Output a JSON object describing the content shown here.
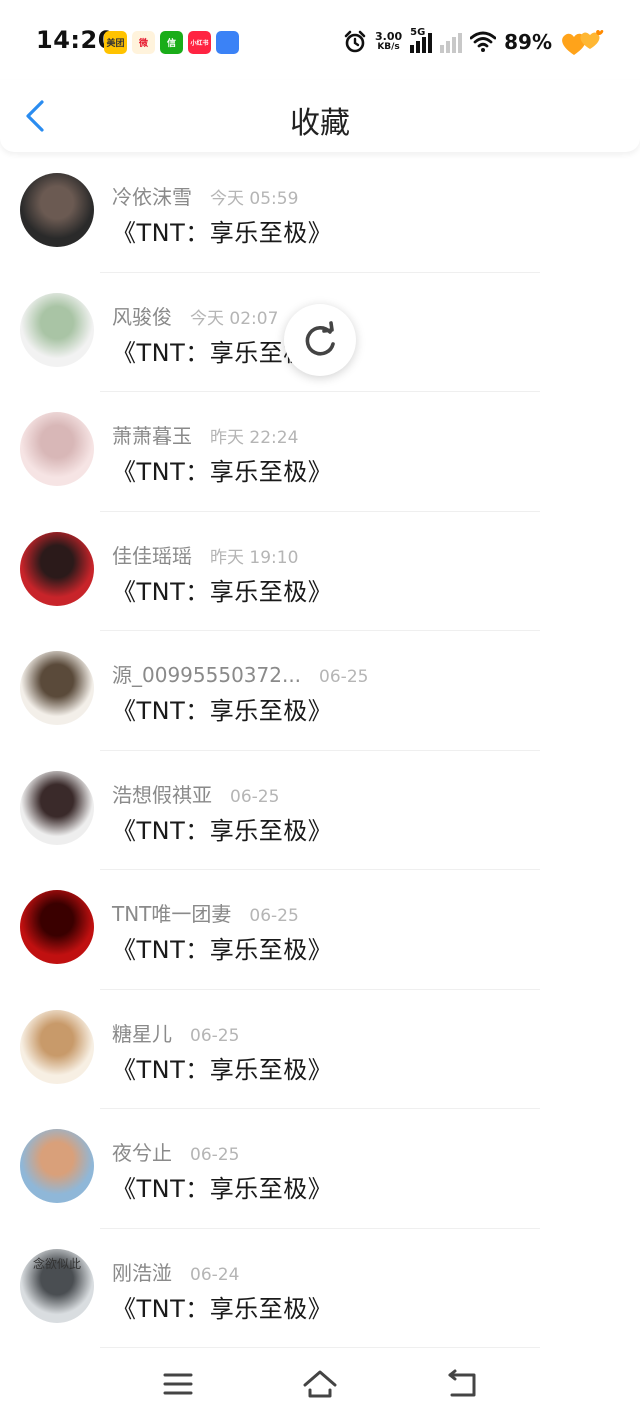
{
  "status_bar": {
    "time": "14:20",
    "apps": [
      {
        "name": "meituan",
        "label": "美团",
        "color": "#ffc300",
        "text_color": "#333333"
      },
      {
        "name": "weibo",
        "label": "微",
        "color": "#fff3dc",
        "text_color": "#e6162d"
      },
      {
        "name": "wechat",
        "label": "信",
        "color": "#1aad19",
        "text_color": "#ffffff"
      },
      {
        "name": "xiaohongshu",
        "label": "小红书",
        "color": "#ff2442",
        "text_color": "#ffffff"
      },
      {
        "name": "app5",
        "label": "",
        "color": "#3b82f6",
        "text_color": "#ffffff"
      }
    ],
    "net_speed_value": "3.00",
    "net_speed_unit": "KB/s",
    "network_type": "5G",
    "battery": "89%"
  },
  "header": {
    "title": "收藏"
  },
  "favorites": [
    {
      "user": "冷依沫雪",
      "time": "今天 05:59",
      "title": "《TNT：享乐至极》",
      "avatar_colors": [
        "#2a2a2a",
        "#6b5a52"
      ]
    },
    {
      "user": "风骏俊",
      "time": "今天 02:07",
      "title": "《TNT：享乐至极》",
      "avatar_colors": [
        "#f2f2f2",
        "#a9c4a5"
      ]
    },
    {
      "user": "萧萧暮玉",
      "time": "昨天 22:24",
      "title": "《TNT：享乐至极》",
      "avatar_colors": [
        "#f6e4e4",
        "#d8b7b7"
      ]
    },
    {
      "user": "佳佳瑶瑶",
      "time": "昨天 19:10",
      "title": "《TNT：享乐至极》",
      "avatar_colors": [
        "#c8242a",
        "#2b1a1a"
      ]
    },
    {
      "user": "源_00995550372...",
      "time": "06-25",
      "title": "《TNT：享乐至极》",
      "avatar_colors": [
        "#f3efe9",
        "#5a4a3a"
      ]
    },
    {
      "user": "浩想假祺亚",
      "time": "06-25",
      "title": "《TNT：享乐至极》",
      "avatar_colors": [
        "#eeeeee",
        "#3a2a2a"
      ]
    },
    {
      "user": "TNT唯一团妻",
      "time": "06-25",
      "title": "《TNT：享乐至极》",
      "avatar_colors": [
        "#c01010",
        "#3a0000"
      ]
    },
    {
      "user": "糖星儿",
      "time": "06-25",
      "title": "《TNT：享乐至极》",
      "avatar_colors": [
        "#f7efe3",
        "#c89a6a"
      ]
    },
    {
      "user": "夜兮止",
      "time": "06-25",
      "title": "《TNT：享乐至极》",
      "avatar_colors": [
        "#8fb7d8",
        "#d9a07a"
      ]
    },
    {
      "user": "刚浩湴",
      "time": "06-24",
      "title": "《TNT：享乐至极》",
      "avatar_colors": [
        "#d9dde0",
        "#4a4e52"
      ],
      "avatar_text": "念欲似此"
    }
  ],
  "icons": {
    "back": "chevron-left-icon",
    "refresh": "refresh-icon",
    "nav_menu": "menu-icon",
    "nav_home": "home-icon",
    "nav_back": "back-icon"
  },
  "colors": {
    "accent": "#2a8cf0",
    "username": "#8a8a8a",
    "timestamp": "#b5b5b5",
    "title_text": "#1a1a1a"
  }
}
